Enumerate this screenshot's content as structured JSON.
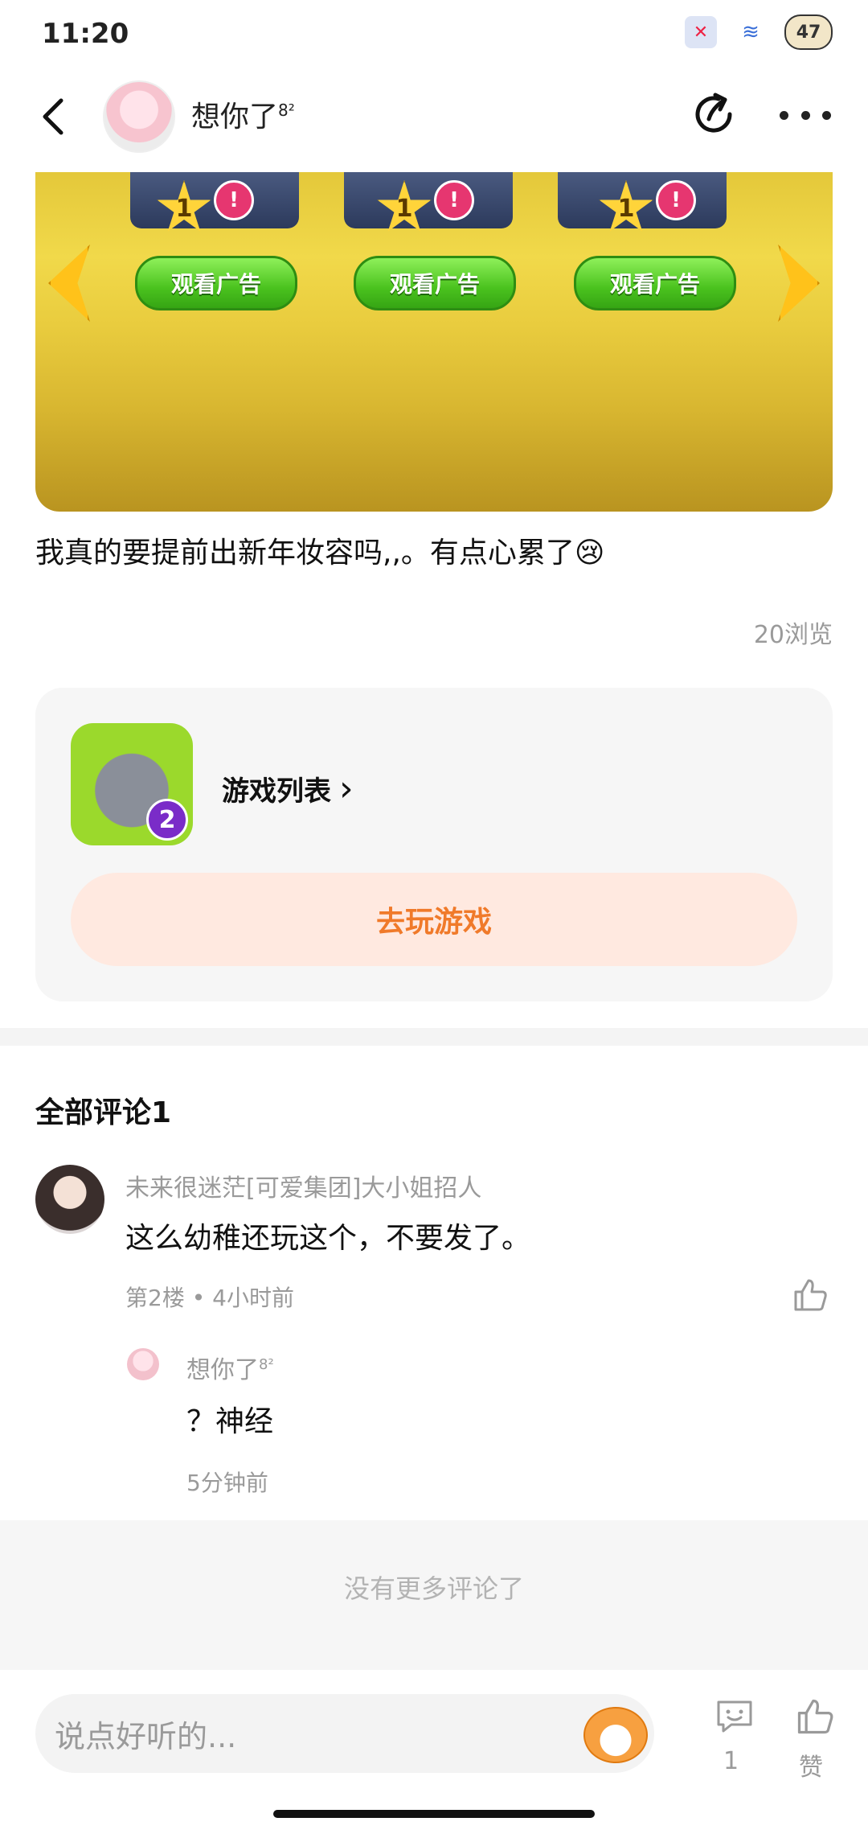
{
  "status_bar": {
    "time": "11:20",
    "battery": "47"
  },
  "header": {
    "title": "想你了",
    "title_sup": "8²"
  },
  "game_image": {
    "ad_labels": [
      "观看广告",
      "观看广告",
      "观看广告"
    ],
    "badge_number": "1",
    "alert_mark": "!"
  },
  "post": {
    "text": "我真的要提前出新年妆容吗,,。有点心累了😢",
    "views": "20浏览"
  },
  "game_card": {
    "link_label": "游戏列表",
    "link_chevron": "›",
    "icon_badge": "2",
    "play_button": "去玩游戏"
  },
  "comments": {
    "title": "全部评论1",
    "items": [
      {
        "name": "未来很迷茫[可爱集团]大小姐招人",
        "text": "这么幼稚还玩这个，不要发了。",
        "meta": "第2楼 • 4小时前",
        "reply": {
          "name": "想你了",
          "name_sup": "8²",
          "text": "？神经",
          "meta": "5分钟前"
        }
      }
    ],
    "no_more": "没有更多评论了"
  },
  "bottom_bar": {
    "input_placeholder": "说点好听的...",
    "comment_count": "1",
    "like_label": "赞"
  },
  "colors": {
    "accent_orange": "#f07a2a",
    "play_button_bg": "#ffe9e0",
    "muted_text": "#9a9a9a"
  },
  "icons": [
    "back-arrow-icon",
    "share-icon",
    "more-icon",
    "chevron-right-icon",
    "like-icon",
    "comment-icon"
  ]
}
